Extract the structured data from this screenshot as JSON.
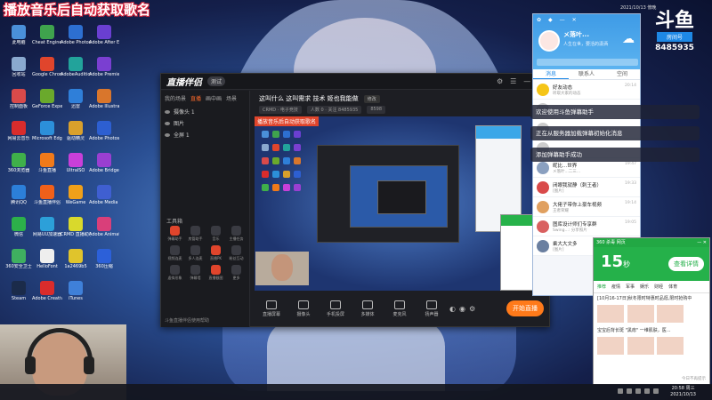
{
  "overlay": {
    "title": "播放音乐后自动获取歌名"
  },
  "desktop": {
    "icons": [
      {
        "label": "此电脑",
        "color": "#4a90d9"
      },
      {
        "label": "Cheat Engine 7.0",
        "color": "#3fa34d"
      },
      {
        "label": "Adobe Photoshop",
        "color": "#2d6fd1"
      },
      {
        "label": "Adobe After Effects",
        "color": "#6a3fd1"
      },
      {
        "label": "回收站",
        "color": "#8aa9cf"
      },
      {
        "label": "Google Chrome",
        "color": "#e0452c"
      },
      {
        "label": "AdobeAudition",
        "color": "#22a39b"
      },
      {
        "label": "Adobe Premiere",
        "color": "#7a3fd1"
      },
      {
        "label": "控制面板",
        "color": "#d94a4a"
      },
      {
        "label": "GeForce Experience",
        "color": "#6aa92c"
      },
      {
        "label": "迅雷",
        "color": "#2f7fd9"
      },
      {
        "label": "Adobe Illustrator",
        "color": "#d9762c"
      },
      {
        "label": "网易云音乐",
        "color": "#d92c2c"
      },
      {
        "label": "Microsoft Edge",
        "color": "#2c8fd9"
      },
      {
        "label": "驱动精灵",
        "color": "#d9a02c"
      },
      {
        "label": "Adobe Photoshop",
        "color": "#2d5fd1"
      },
      {
        "label": "360浏览器",
        "color": "#3fb04a"
      },
      {
        "label": "斗鱼直播",
        "color": "#f07a1a"
      },
      {
        "label": "UltraISO",
        "color": "#c93fd9"
      },
      {
        "label": "Adobe Bridge",
        "color": "#9a3fd1"
      },
      {
        "label": "腾讯QQ",
        "color": "#2c7fd9"
      },
      {
        "label": "斗鱼直播伴侣",
        "color": "#f0601a"
      },
      {
        "label": "WeGame",
        "color": "#f0a01a"
      },
      {
        "label": "Adobe Media Encoder",
        "color": "#3f5fd1"
      },
      {
        "label": "微信",
        "color": "#2cb04a"
      },
      {
        "label": "网易UU加速器",
        "color": "#2ca0d9"
      },
      {
        "label": "CRMD 直播助手",
        "color": "#d9d92c"
      },
      {
        "label": "Adobe Animate",
        "color": "#d93f7a"
      },
      {
        "label": "360安全卫士",
        "color": "#3fb060"
      },
      {
        "label": "HelloFont",
        "color": "#eeeeee"
      },
      {
        "label": "1a2469b5",
        "color": "#e0c42c"
      },
      {
        "label": "360压缩",
        "color": "#2c60d9"
      },
      {
        "label": "Steam",
        "color": "#1b2b4a"
      },
      {
        "label": "Adobe Creative Cloud",
        "color": "#d92c2c"
      },
      {
        "label": "iTunes",
        "color": "#3f80d9"
      }
    ]
  },
  "main_window": {
    "logo": "直播伴侣",
    "badge": "测试",
    "tabs": [
      "我的场景",
      "直播",
      "画中画",
      "场景"
    ],
    "scenes": [
      "摄像头 1",
      "图片",
      "全屏 1"
    ],
    "live_title": "这叫什么 这叫需求  技术 姬也我能做",
    "edit_label": "修改",
    "meta": [
      "CRMD · 电子竞技",
      "人数 0 · 关注 8485935",
      "8598"
    ],
    "preview_label": "播放音乐后自动获取歌名",
    "tools_title": "工具箱",
    "tools": [
      {
        "label": "弹幕助手",
        "hot": true
      },
      {
        "label": "房管助手",
        "hot": false
      },
      {
        "label": "音乐",
        "hot": false
      },
      {
        "label": "主播任务",
        "hot": false
      },
      {
        "label": "视频连麦",
        "hot": false
      },
      {
        "label": "多人连麦",
        "hot": false
      },
      {
        "label": "直播PK",
        "hot": true
      },
      {
        "label": "粉丝互动",
        "hot": false
      },
      {
        "label": "虚拟形象",
        "hot": false
      },
      {
        "label": "弹幕墙",
        "hot": false
      },
      {
        "label": "直播截图",
        "hot": true
      },
      {
        "label": "更多",
        "hot": false
      }
    ],
    "left_footer": "斗鱼直播伴侣使用帮助",
    "bottom_tools": [
      "直播屏幕",
      "摄像头",
      "手机投屏",
      "多媒体",
      "麦克风",
      "扬声器"
    ],
    "go_live": "开始直播"
  },
  "qq": {
    "name": "メ落叶...",
    "signature": "人生在世，要活的潇洒",
    "tabs": [
      "消息",
      "联系人",
      "空间"
    ],
    "items": [
      {
        "title": "好友动态",
        "sub": "听取大家的动态",
        "time": "20:14",
        "color": "#f5c518"
      },
      {
        "title": "",
        "sub": "",
        "time": "",
        "color": "#cccccc"
      },
      {
        "title": "",
        "sub": "",
        "time": "",
        "color": "#cccccc"
      },
      {
        "title": "",
        "sub": "",
        "time": "",
        "color": "#cccccc"
      },
      {
        "title": "昵比...世界",
        "sub": "メ落叶...二三...",
        "time": "19:47",
        "color": "#8aa0c0"
      },
      {
        "title": "闭眼我就静（刺王者）",
        "sub": "[图片]",
        "time": "19:33",
        "color": "#d94a4a"
      },
      {
        "title": "大佬子带你上豪车视频",
        "sub": "王者荣耀",
        "time": "19:14",
        "color": "#e0a060"
      },
      {
        "title": "图库设计师们专享群",
        "sub": "Swing...: 分享照片",
        "time": "19:05",
        "color": "#d96060"
      },
      {
        "title": "乘大大文多",
        "sub": "[图片]",
        "time": "",
        "color": "#6a7fa0"
      }
    ]
  },
  "notifications": [
    "欢迎使用斗鱼弹幕助手",
    "正在从服务器加载弹幕初始化消息",
    "添加弹幕助手成功"
  ],
  "brand": {
    "main": "斗鱼",
    "tag": "房间号",
    "room": "8485935"
  },
  "sysinfo": "2021/10/13 傍晚",
  "ad": {
    "header": "360 杀毒 网页",
    "seconds": "15",
    "seconds_unit": "秒",
    "detail": "查看详情",
    "tabs": [
      "推荐",
      "疫情",
      "军事",
      "娱乐",
      "财经",
      "体育"
    ],
    "headline": "[10月16-17日]秋冬限时特惠时品逛,限时抢购中",
    "sub": "宝宝后背长斑 \"黑痣\" 一维肌肤，医...",
    "foot": "今日不再提示"
  },
  "taskbar": {
    "time": "20:58 周三",
    "date": "2021/10/13"
  }
}
